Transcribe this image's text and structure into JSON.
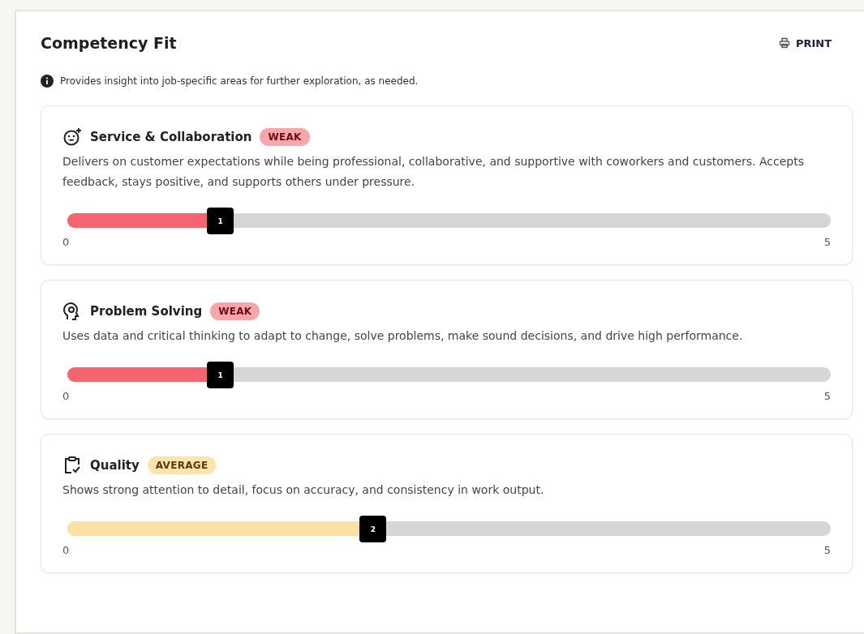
{
  "title": "Competency Fit",
  "print_button": {
    "label": "PRINT"
  },
  "info_note": "Provides insight into job-specific areas for further exploration, as needed.",
  "competencies": [
    {
      "name": "Service & Collaboration",
      "badge": "WEAK",
      "kind": "weak",
      "description": "Delivers on customer expectations while being professional, collaborative, and supportive with coworkers and customers. Accepts feedback, stays positive, and supports others under pressure.",
      "level": 0.2,
      "thumb_label": "1",
      "min_label": "0",
      "max_label": "5"
    },
    {
      "name": "Problem Solving",
      "badge": "WEAK",
      "kind": "weak",
      "description": "Uses data and critical thinking to adapt to change, solve problems, make sound decisions, and drive high performance.",
      "level": 0.2,
      "thumb_label": "1",
      "min_label": "0",
      "max_label": "5"
    },
    {
      "name": "Quality",
      "badge": "AVERAGE",
      "kind": "average",
      "description": "Shows strong attention to detail, focus on accuracy, and consistency in work output.",
      "level": 0.4,
      "thumb_label": "2",
      "min_label": "0",
      "max_label": "5"
    }
  ]
}
